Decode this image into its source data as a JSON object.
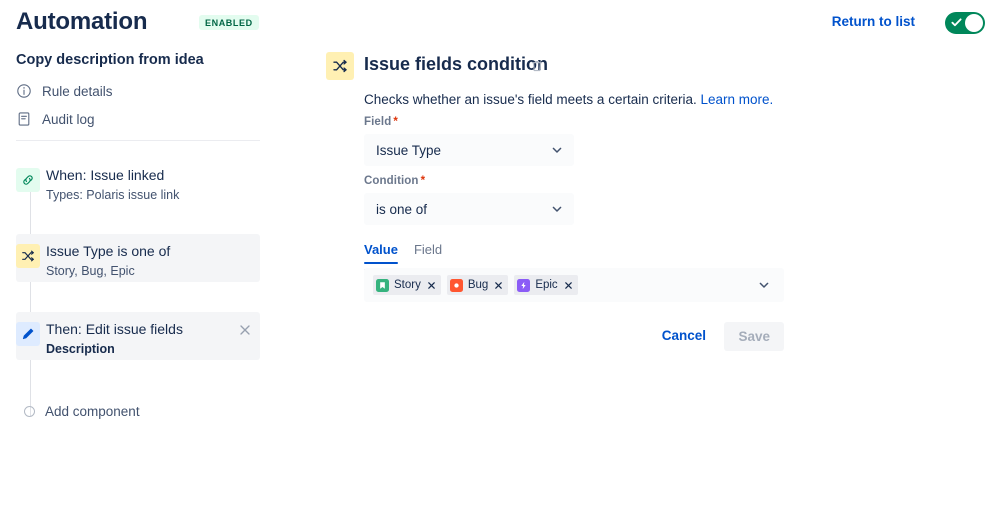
{
  "topbar": {
    "app_title": "Automation",
    "status_badge": "ENABLED",
    "return_link": "Return to list",
    "toggle_icon": "check-icon",
    "toggle_on": true,
    "accent_blue": "#0052CC",
    "toggle_green": "#00875A",
    "badge_bg": "#E3FCEF",
    "badge_fg": "#006644"
  },
  "sidebar": {
    "rule_name": "Copy description from idea",
    "nav": [
      {
        "label": "Rule details",
        "icon": "info-circle-icon"
      },
      {
        "label": "Audit log",
        "icon": "document-log-icon"
      }
    ],
    "components": [
      {
        "title": "When: Issue linked",
        "subtitle": "Types: Polaris issue link",
        "icon": "link-icon",
        "badge_color": "#E3FCEF",
        "selected": false,
        "closable": false
      },
      {
        "title": "Issue Type is one of",
        "subtitle": "Story, Bug, Epic",
        "icon": "shuffle-icon",
        "badge_color": "#FFF0B3",
        "selected": true,
        "closable": false
      },
      {
        "title": "Then: Edit issue fields",
        "subtitle": "Description",
        "icon": "pencil-icon",
        "badge_color": "#DEEBFF",
        "selected": true,
        "closable": true,
        "close_icon": "close-icon"
      }
    ],
    "add_component": {
      "label": "Add component",
      "icon": "circle-outline-icon"
    }
  },
  "main": {
    "header": {
      "icon": "shuffle-icon",
      "badge_color": "#FFF0B3",
      "title": "Issue fields condition",
      "delete_icon": "trash-icon"
    },
    "description": {
      "text": "Checks whether an issue's field meets a certain criteria. ",
      "link_text": "Learn more."
    },
    "field_group": {
      "label": "Field",
      "required": "*",
      "value": "Issue Type",
      "chevron_icon": "chevron-down-icon"
    },
    "condition_group": {
      "label": "Condition",
      "required": "*",
      "value": "is one of",
      "chevron_icon": "chevron-down-icon"
    },
    "tabs": [
      {
        "label": "Value",
        "active": true
      },
      {
        "label": "Field",
        "active": false
      }
    ],
    "value_select": {
      "chevron_icon": "chevron-down-icon",
      "chips": [
        {
          "label": "Story",
          "icon": "story-icon",
          "icon_color": "#36B37E",
          "remove_icon": "close-icon"
        },
        {
          "label": "Bug",
          "icon": "bug-icon",
          "icon_color": "#FF5630",
          "remove_icon": "close-icon"
        },
        {
          "label": "Epic",
          "icon": "epic-icon",
          "icon_color": "#8B5CF6",
          "remove_icon": "close-icon"
        }
      ]
    },
    "actions": {
      "cancel_label": "Cancel",
      "save_label": "Save",
      "save_disabled": true
    }
  }
}
